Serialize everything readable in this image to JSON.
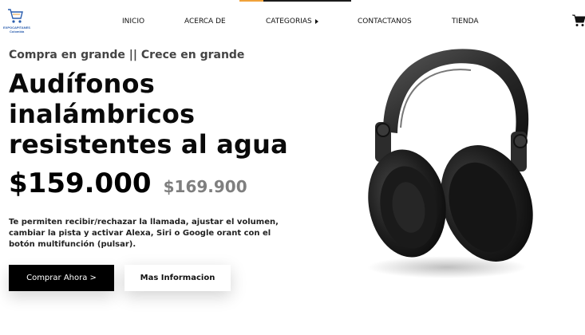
{
  "brand": {
    "logo_text_line1": "EXPOCAPITANES",
    "logo_text_line2": "Colombia"
  },
  "nav": {
    "items": [
      {
        "label": "INICIO"
      },
      {
        "label": "ACERCA DE"
      },
      {
        "label": "CATEGORIAS"
      },
      {
        "label": "CONTACTANOS"
      },
      {
        "label": "TIENDA"
      }
    ]
  },
  "hero": {
    "tagline": "Compra en grande || Crece en grande",
    "title_lines": [
      "Audífonos",
      "inalámbricos",
      "resistentes al agua"
    ],
    "price_current": "$159.000",
    "price_old": "$169.900",
    "description": "Te permiten recibir/rechazar la llamada, ajustar el volumen, cambiar la pista y activar Alexa, Siri o Google orant con el botón multifunción (pulsar).",
    "primary_button": "Comprar Ahora >",
    "secondary_button": "Mas Informacion"
  },
  "colors": {
    "accent": "#f0a23a",
    "text_dark": "#0a0a0a",
    "price_old": "#7f7f7f",
    "button_primary": "#000000"
  },
  "icons": {
    "cart": "shopping-cart-icon",
    "caret": "caret-right-icon"
  }
}
